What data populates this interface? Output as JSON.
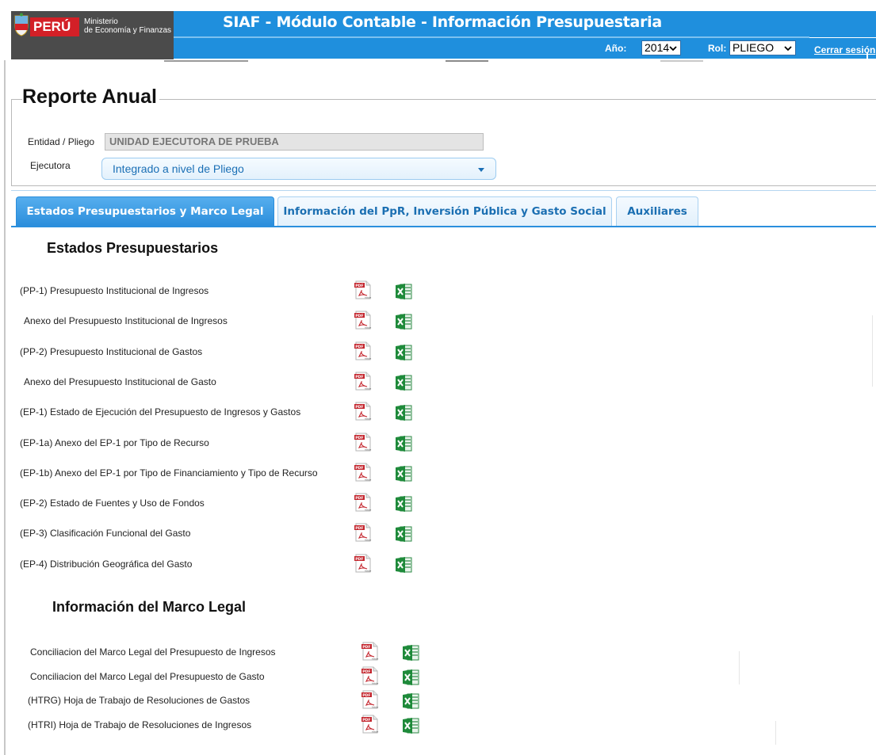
{
  "header": {
    "logo_country": "PERÚ",
    "logo_ministry_line1": "Ministerio",
    "logo_ministry_line2": "de Economía y Finanzas",
    "app_title": "SIAF - Módulo Contable - Información Presupuestaria",
    "anio_label": "Año:",
    "anio_value": "2014",
    "rol_label": "Rol:",
    "rol_value": "PLIEGO",
    "logout_label": "Cerrar sesión"
  },
  "form": {
    "legend": "Reporte Anual",
    "entidad_label": "Entidad / Pliego",
    "entidad_value": "UNIDAD EJECUTORA DE PRUEBA",
    "ejecutora_label": "Ejecutora",
    "ejecutora_value": "Integrado a nivel de Pliego"
  },
  "tabs": [
    {
      "label": "Estados Presupuestarios y Marco Legal",
      "active": true
    },
    {
      "label": "Información del PpR, Inversión Pública y Gasto Social",
      "active": false
    },
    {
      "label": "Auxiliares",
      "active": false
    }
  ],
  "sections": {
    "estados_title": "Estados Presupuestarios",
    "marco_title": "Información del Marco Legal"
  },
  "estados_reports": [
    "(PP-1) Presupuesto Institucional de Ingresos",
    "Anexo del Presupuesto Institucional de Ingresos",
    "(PP-2) Presupuesto Institucional de Gastos",
    "Anexo del Presupuesto Institucional de Gasto",
    "(EP-1) Estado de Ejecución del Presupuesto de Ingresos y Gastos",
    "(EP-1a) Anexo del EP-1 por Tipo de Recurso",
    "(EP-1b) Anexo del EP-1 por Tipo de Financiamiento y Tipo de Recurso",
    "(EP-2) Estado de Fuentes y Uso de Fondos",
    "(EP-3) Clasificación Funcional del Gasto",
    "(EP-4) Distribución Geográfica del Gasto"
  ],
  "marco_reports": [
    "Conciliacion del Marco Legal del Presupuesto de Ingresos",
    "Conciliacion del Marco Legal del Presupuesto de Gasto",
    "(HTRG) Hoja de Trabajo de Resoluciones de Gastos",
    "(HTRI) Hoja de Trabajo de Resoluciones de Ingresos"
  ],
  "icons": {
    "pdf": "pdf-icon",
    "excel": "excel-icon",
    "dropdown": "chevron-down-icon"
  },
  "colors": {
    "header_blue": "#1f8fdd",
    "tab_active": "#2a8ddb",
    "tab_text": "#1b6fb2",
    "peru_red": "#d32027",
    "excel_green": "#1e8a3a",
    "pdf_red": "#c4262e"
  }
}
